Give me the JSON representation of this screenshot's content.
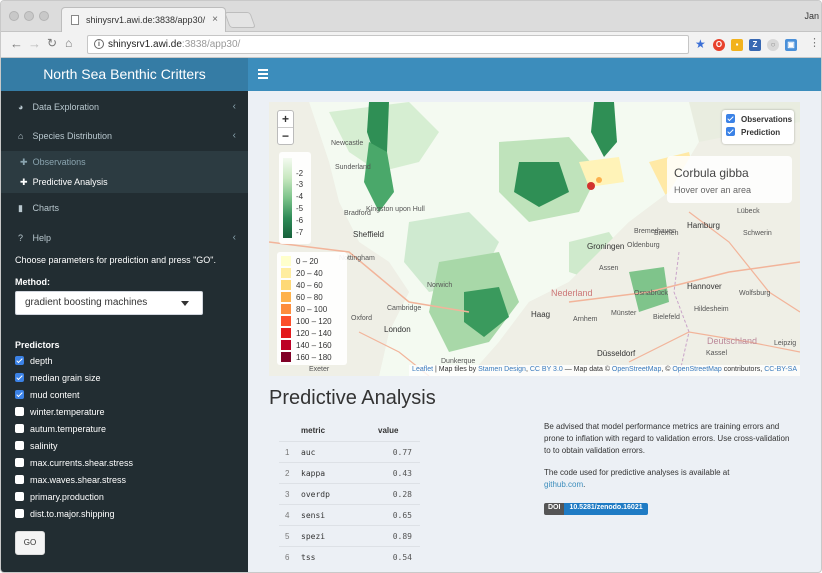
{
  "browser": {
    "tab_title": "shinysrv1.awi.de:3838/app30/",
    "tab_close": "×",
    "profile_name": "Jan",
    "url_host": "shinysrv1.awi.de",
    "url_path": ":3838/app30/",
    "info_glyph": "i"
  },
  "app": {
    "brand": "North Sea Benthic Critters",
    "accent": "#3c8dbc"
  },
  "sidebar": {
    "items": [
      {
        "label": "Data Exploration",
        "icon": "dashboard-icon"
      },
      {
        "label": "Species Distribution",
        "icon": "home-icon"
      },
      {
        "label": "Charts",
        "icon": "bar-chart-icon"
      },
      {
        "label": "Help",
        "icon": "question-icon"
      }
    ],
    "sub_items": [
      "Observations",
      "Predictive Analysis"
    ],
    "instruction": "Choose parameters for prediction and press \"GO\".",
    "method_label": "Method:",
    "method_value": "gradient boosting machines",
    "predictors_label": "Predictors",
    "predictors": [
      {
        "label": "depth",
        "checked": true
      },
      {
        "label": "median grain size",
        "checked": true
      },
      {
        "label": "mud content",
        "checked": true
      },
      {
        "label": "winter.temperature",
        "checked": false
      },
      {
        "label": "autum.temperature",
        "checked": false
      },
      {
        "label": "salinity",
        "checked": false
      },
      {
        "label": "max.currents.shear.stress",
        "checked": false
      },
      {
        "label": "max.waves.shear.stress",
        "checked": false
      },
      {
        "label": "primary.production",
        "checked": false
      },
      {
        "label": "dist.to.major.shipping",
        "checked": false
      }
    ],
    "go_label": "GO"
  },
  "map": {
    "zoom_in": "+",
    "zoom_out": "−",
    "depth_ticks": [
      "-2",
      "-3",
      "-4",
      "-5",
      "-6",
      "-7"
    ],
    "prediction_legend": [
      {
        "label": "0 – 20",
        "color": "#ffffcc"
      },
      {
        "label": "20 – 40",
        "color": "#ffeda0"
      },
      {
        "label": "40 – 60",
        "color": "#fed976"
      },
      {
        "label": "60 – 80",
        "color": "#feb24c"
      },
      {
        "label": "80 – 100",
        "color": "#fd8d3c"
      },
      {
        "label": "100 – 120",
        "color": "#fc4e2a"
      },
      {
        "label": "120 – 140",
        "color": "#e31a1c"
      },
      {
        "label": "140 – 160",
        "color": "#bd0026"
      },
      {
        "label": "160 – 180",
        "color": "#800026"
      }
    ],
    "layers": [
      "Observations",
      "Prediction"
    ],
    "info_title": "Corbula gibba",
    "info_sub": "Hover over an area",
    "attribution": {
      "leaflet": "Leaflet",
      "text1": " | Map tiles by ",
      "stamen": "Stamen Design",
      "text2": ", ",
      "ccby": "CC BY 3.0",
      "text3": " — Map data © ",
      "osm": "OpenStreetMap",
      "text4": ", © ",
      "osm2": "OpenStreetMap",
      "text5": " contributors, ",
      "ccbysa": "CC-BY-SA"
    },
    "places": [
      "Sheffield",
      "Bradford",
      "London",
      "Cambridge",
      "Oxford",
      "Norwich",
      "Groningen",
      "Oldenburg",
      "Bremen",
      "Hamburg",
      "Lübeck",
      "Schwerin",
      "Bremerhaven",
      "Assen",
      "Nederland",
      "Osnabrück",
      "Hannover",
      "Wolfsburg",
      "Hildesheim",
      "Haag",
      "Arnhem",
      "Münster",
      "Bielefeld",
      "Düsseldorf",
      "Kassel",
      "Deutschland",
      "Leipzig",
      "Dunkerque",
      "Exeter",
      "Newcastle",
      "Sunderland",
      "Nottingham",
      "Kingston upon Hull"
    ]
  },
  "content": {
    "title": "Predictive Analysis",
    "table_headers": [
      "metric",
      "value"
    ],
    "table_rows": [
      {
        "idx": "1",
        "metric": "auc",
        "value": "0.77"
      },
      {
        "idx": "2",
        "metric": "kappa",
        "value": "0.43"
      },
      {
        "idx": "3",
        "metric": "overdp",
        "value": "0.28"
      },
      {
        "idx": "4",
        "metric": "sensi",
        "value": "0.65"
      },
      {
        "idx": "5",
        "metric": "spezi",
        "value": "0.89"
      },
      {
        "idx": "6",
        "metric": "tss",
        "value": "0.54"
      }
    ],
    "note1": "Be advised that model performance metrics are training errors and prone to inflation with regard to validation errors. Use cross-validation to to obtain validation errors.",
    "note2_prefix": "The code used for predictive analyses is available at",
    "note2_link": "github.com",
    "note2_suffix": ".",
    "doi_key": "DOI",
    "doi_value": "10.5281/zenodo.16021"
  }
}
